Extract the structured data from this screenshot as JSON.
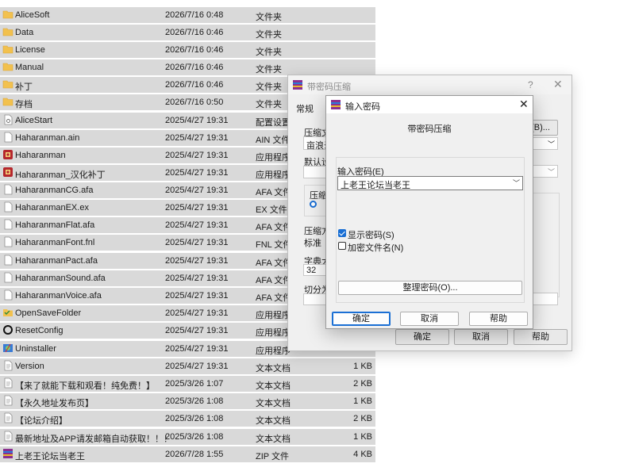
{
  "files": [
    {
      "name": "AliceSoft",
      "date": "2026/7/16 0:48",
      "type": "文件夹",
      "size": "",
      "icon": "folder-icon"
    },
    {
      "name": "Data",
      "date": "2026/7/16 0:46",
      "type": "文件夹",
      "size": "",
      "icon": "folder-icon"
    },
    {
      "name": "License",
      "date": "2026/7/16 0:46",
      "type": "文件夹",
      "size": "",
      "icon": "folder-icon"
    },
    {
      "name": "Manual",
      "date": "2026/7/16 0:46",
      "type": "文件夹",
      "size": "",
      "icon": "folder-icon"
    },
    {
      "name": "补丁",
      "date": "2026/7/16 0:46",
      "type": "文件夹",
      "size": "",
      "icon": "folder-icon"
    },
    {
      "name": "存档",
      "date": "2026/7/16 0:50",
      "type": "文件夹",
      "size": "",
      "icon": "folder-icon"
    },
    {
      "name": "AliceStart",
      "date": "2025/4/27 19:31",
      "type": "配置设置",
      "size": "",
      "icon": "settings-file-icon"
    },
    {
      "name": "Haharanman.ain",
      "date": "2025/4/27 19:31",
      "type": "AIN 文件",
      "size": "",
      "icon": "file-icon"
    },
    {
      "name": "Haharanman",
      "date": "2025/4/27 19:31",
      "type": "应用程序",
      "size": "",
      "icon": "game-app-icon"
    },
    {
      "name": "Haharanman_汉化补丁",
      "date": "2025/4/27 19:31",
      "type": "应用程序",
      "size": "",
      "icon": "game-app-icon"
    },
    {
      "name": "HaharanmanCG.afa",
      "date": "2025/4/27 19:31",
      "type": "AFA 文件",
      "size": "",
      "icon": "file-icon"
    },
    {
      "name": "HaharanmanEX.ex",
      "date": "2025/4/27 19:31",
      "type": "EX 文件",
      "size": "",
      "icon": "file-icon"
    },
    {
      "name": "HaharanmanFlat.afa",
      "date": "2025/4/27 19:31",
      "type": "AFA 文件",
      "size": "",
      "icon": "file-icon"
    },
    {
      "name": "HaharanmanFont.fnl",
      "date": "2025/4/27 19:31",
      "type": "FNL 文件",
      "size": "",
      "icon": "file-icon"
    },
    {
      "name": "HaharanmanPact.afa",
      "date": "2025/4/27 19:31",
      "type": "AFA 文件",
      "size": "",
      "icon": "file-icon"
    },
    {
      "name": "HaharanmanSound.afa",
      "date": "2025/4/27 19:31",
      "type": "AFA 文件",
      "size": "",
      "icon": "file-icon"
    },
    {
      "name": "HaharanmanVoice.afa",
      "date": "2025/4/27 19:31",
      "type": "AFA 文件",
      "size": "",
      "icon": "file-icon"
    },
    {
      "name": "OpenSaveFolder",
      "date": "2025/4/27 19:31",
      "type": "应用程序",
      "size": "",
      "icon": "open-folder-app-icon"
    },
    {
      "name": "ResetConfig",
      "date": "2025/4/27 19:31",
      "type": "应用程序",
      "size": "",
      "icon": "reset-app-icon"
    },
    {
      "name": "Uninstaller",
      "date": "2025/4/27 19:31",
      "type": "应用程序",
      "size": "",
      "icon": "uninstaller-app-icon"
    },
    {
      "name": "Version",
      "date": "2025/4/27 19:31",
      "type": "文本文档",
      "size": "1 KB",
      "icon": "text-file-icon"
    },
    {
      "name": "【来了就能下载和观看！纯免费！】",
      "date": "2025/3/26 1:07",
      "type": "文本文档",
      "size": "2 KB",
      "icon": "text-file-icon"
    },
    {
      "name": "【永久地址发布页】",
      "date": "2025/3/26 1:08",
      "type": "文本文档",
      "size": "1 KB",
      "icon": "text-file-icon"
    },
    {
      "name": "【论坛介绍】",
      "date": "2025/3/26 1:08",
      "type": "文本文档",
      "size": "2 KB",
      "icon": "text-file-icon"
    },
    {
      "name": "最新地址及APP请发邮箱自动获取！！！",
      "date": "2025/3/26 1:08",
      "type": "文本文档",
      "size": "1 KB",
      "icon": "text-file-icon"
    },
    {
      "name": "上老王论坛当老王",
      "date": "2026/7/28 1:55",
      "type": "ZIP 文件",
      "size": "4 KB",
      "icon": "winrar-archive-icon"
    }
  ],
  "back_dialog": {
    "title": "带密码压缩",
    "help": "?",
    "close": "✕",
    "tab_general": "常规",
    "label_archive_name": "压缩文",
    "field_archive_name": "亩浪录",
    "label_default": "默认设",
    "label_format": "压缩",
    "label_method": "压缩方",
    "field_method": "标准",
    "label_dict": "字典大",
    "field_dict": "32",
    "label_split": "切分为",
    "browse_button": "(B)...",
    "size_suffix": "",
    "ok_button": "确定",
    "cancel_button": "取消",
    "help_button": "帮助"
  },
  "front_dialog": {
    "title": "输入密码",
    "close": "✕",
    "header": "带密码压缩",
    "password_label": "输入密码(E)",
    "password_value": "上老王论坛当老王",
    "show_password_label": "显示密码(S)",
    "show_password_checked": true,
    "encrypt_names_label": "加密文件名(N)",
    "encrypt_names_checked": false,
    "organize_button": "整理密码(O)...",
    "ok_button": "确定",
    "cancel_button": "取消",
    "help_button": "帮助"
  },
  "colors": {
    "row_bg": "#d9d9d9",
    "folder": "#f2c14e",
    "accent": "#1a6fd4"
  }
}
